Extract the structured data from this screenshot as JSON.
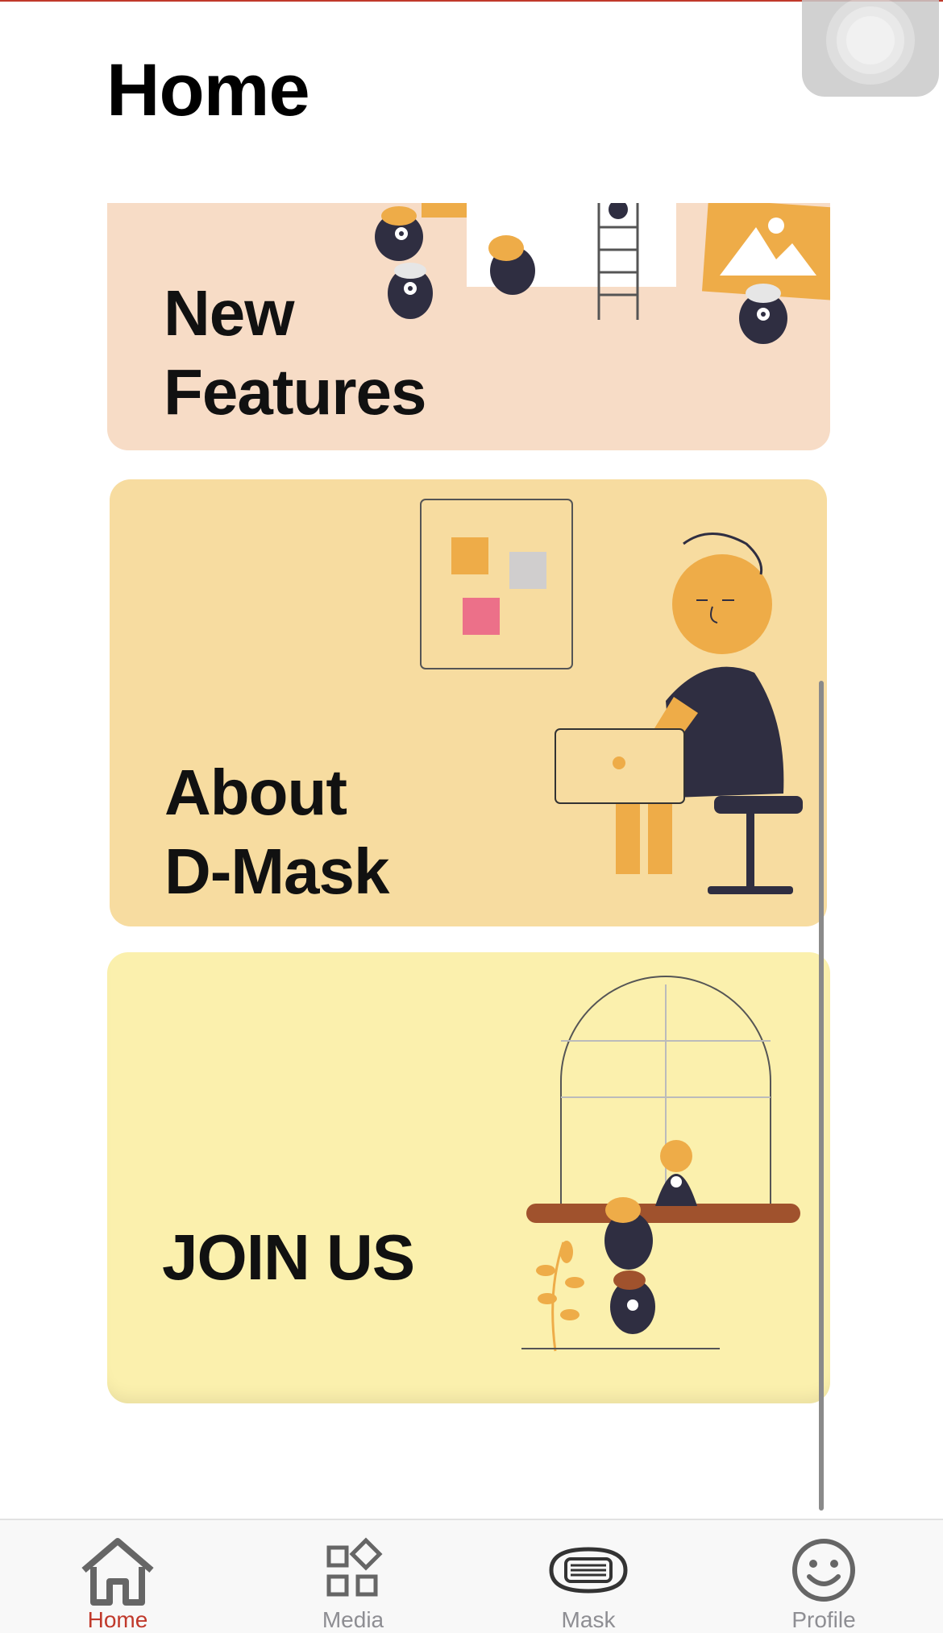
{
  "header": {
    "title": "Home"
  },
  "cards": {
    "features": {
      "label": "New\nFeatures"
    },
    "about": {
      "label": "About\nD-Mask"
    },
    "join": {
      "label": "JOIN US"
    }
  },
  "tabs": [
    {
      "label": "Home",
      "icon": "home-icon",
      "active": true
    },
    {
      "label": "Media",
      "icon": "apps-icon",
      "active": false
    },
    {
      "label": "Mask",
      "icon": "mask-icon",
      "active": false
    },
    {
      "label": "Profile",
      "icon": "smiley-icon",
      "active": false
    }
  ],
  "colors": {
    "accent": "#c0392b",
    "card_features": "#f7dcc6",
    "card_about": "#f7dca0",
    "card_join": "#fbf0ad"
  }
}
